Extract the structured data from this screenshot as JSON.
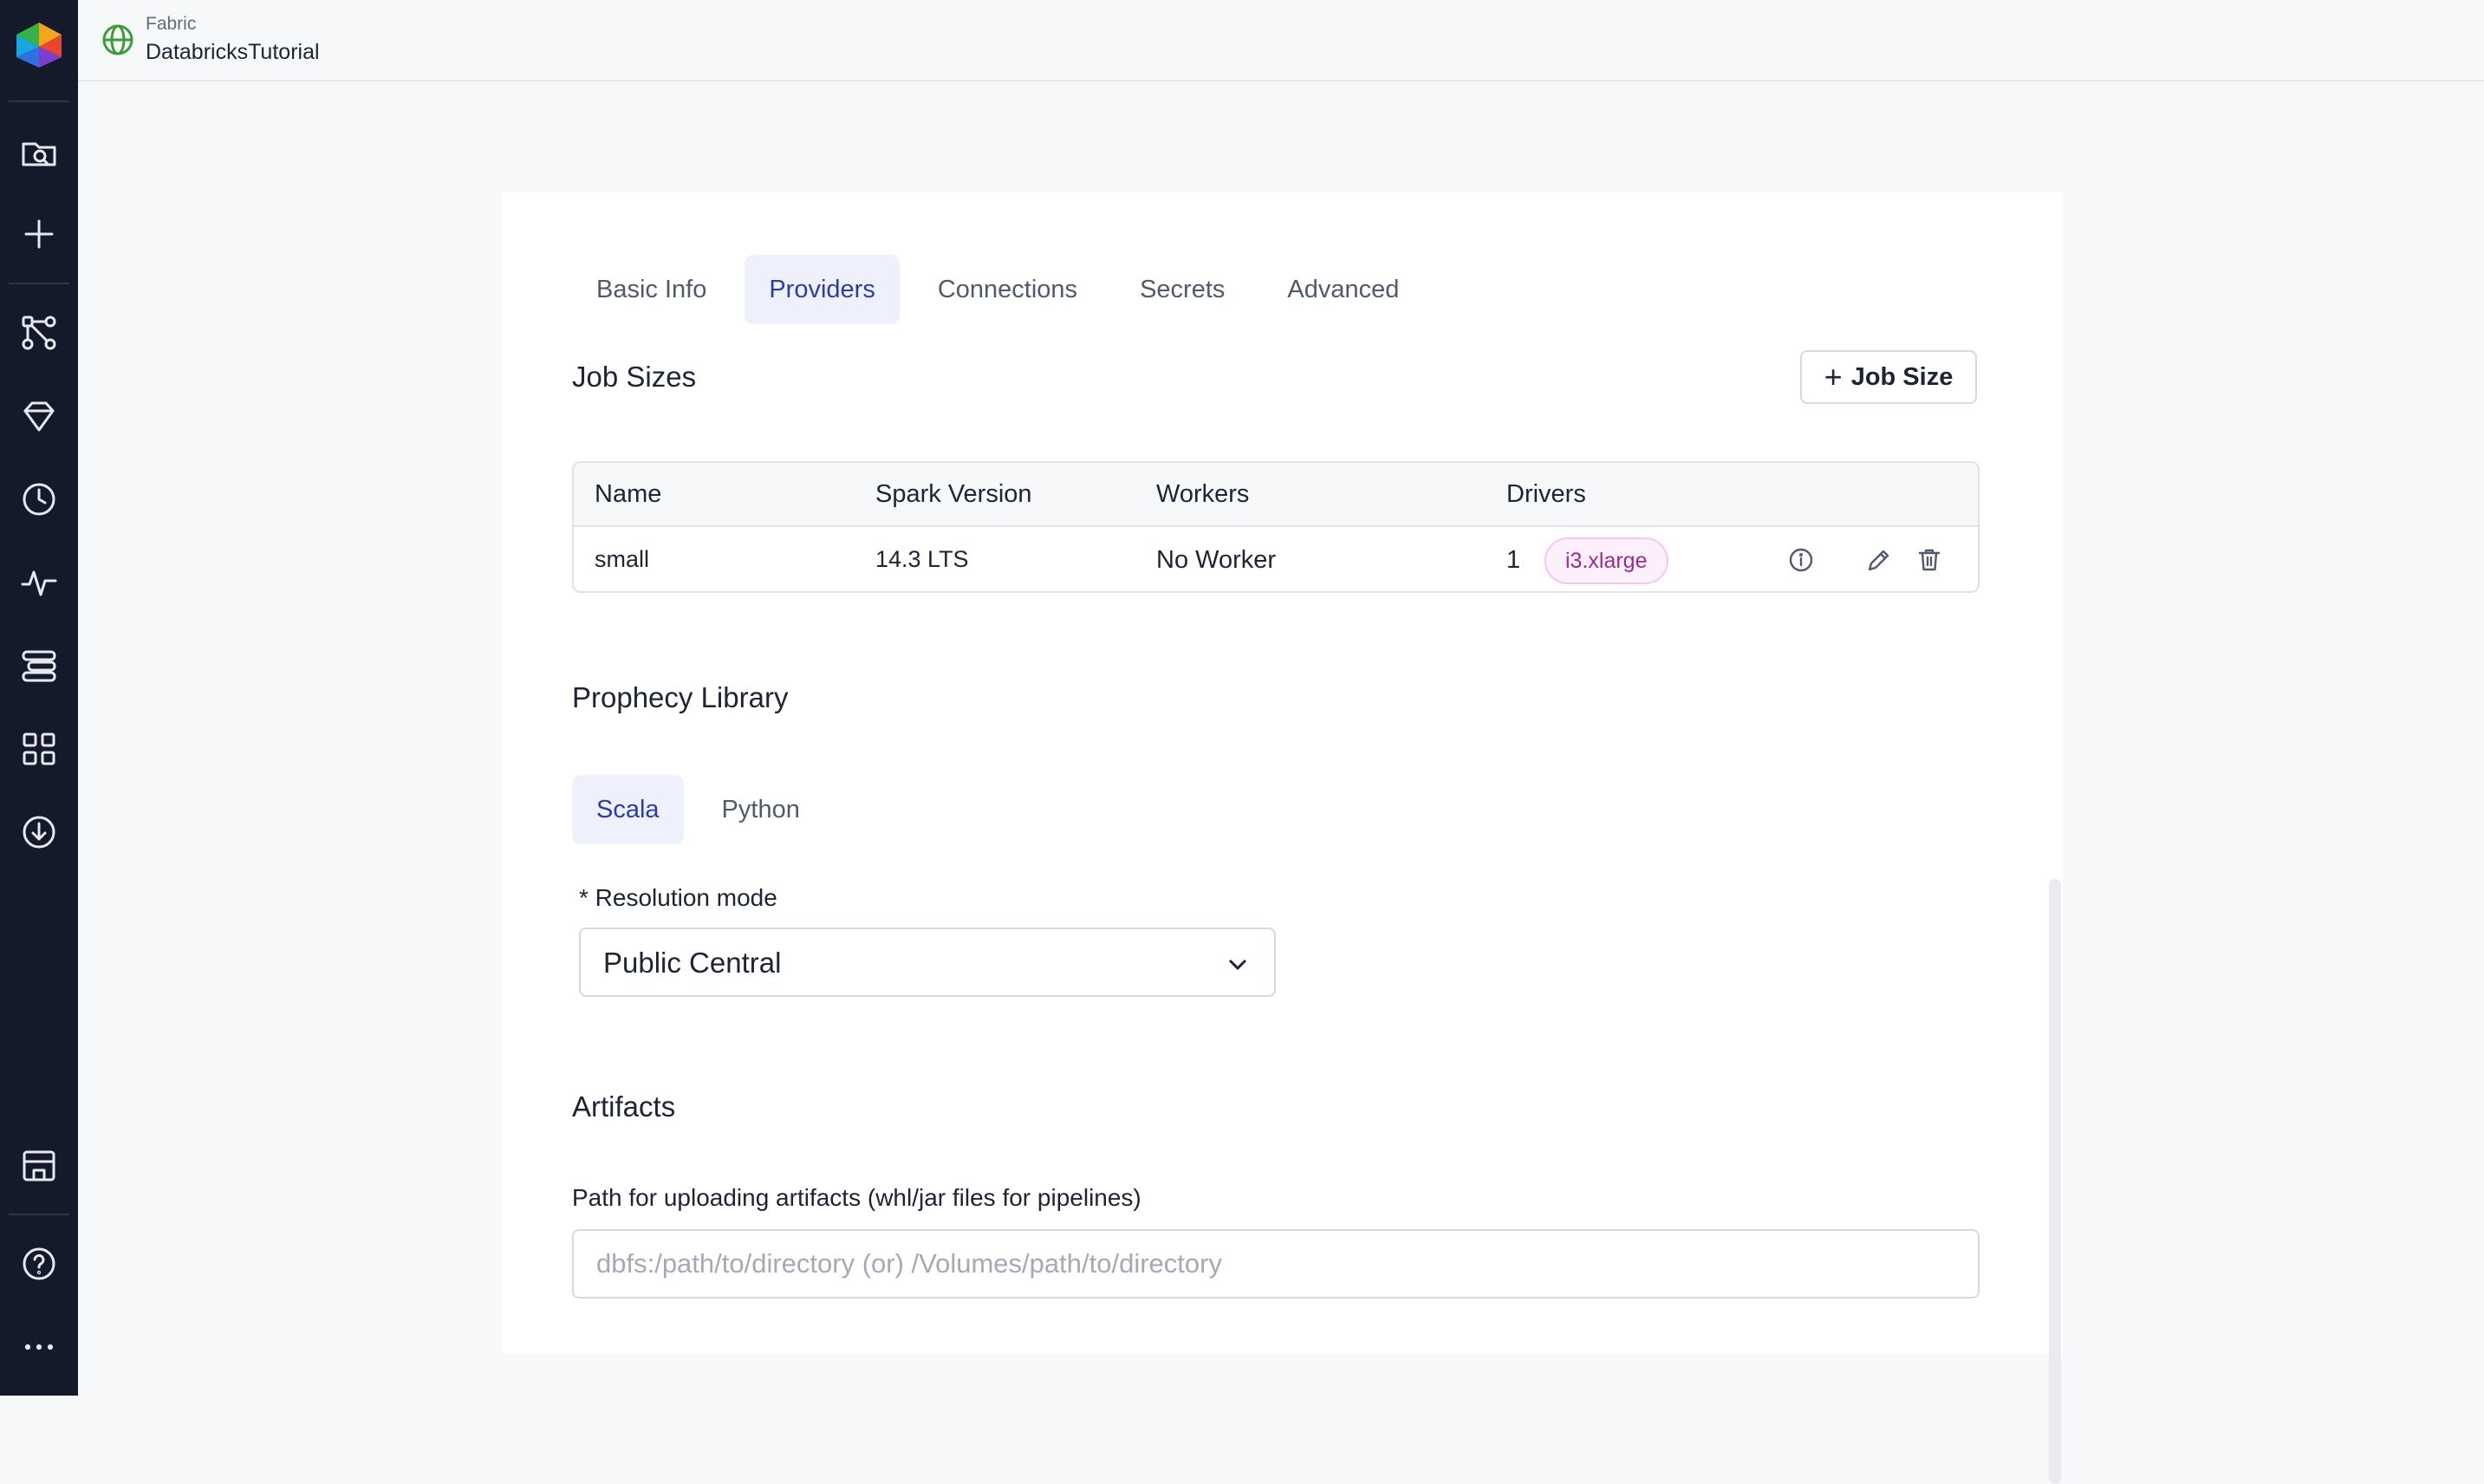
{
  "sidebar": {
    "items": [
      {
        "icon": "folder-search-icon"
      },
      {
        "icon": "plus-icon"
      },
      {
        "icon": "pipeline-icon"
      },
      {
        "icon": "diamond-icon"
      },
      {
        "icon": "clock-icon"
      },
      {
        "icon": "activity-icon"
      },
      {
        "icon": "stack-icon"
      },
      {
        "icon": "grid-icon"
      },
      {
        "icon": "download-icon"
      },
      {
        "icon": "store-icon"
      },
      {
        "icon": "help-icon"
      },
      {
        "icon": "more-icon"
      }
    ]
  },
  "header": {
    "kicker": "Fabric",
    "title": "DatabricksTutorial",
    "icon": "globe-icon"
  },
  "tabs": [
    {
      "label": "Basic Info",
      "active": false
    },
    {
      "label": "Providers",
      "active": true
    },
    {
      "label": "Connections",
      "active": false
    },
    {
      "label": "Secrets",
      "active": false
    },
    {
      "label": "Advanced",
      "active": false
    }
  ],
  "job_sizes": {
    "title": "Job Sizes",
    "add_button": "Job Size",
    "columns": [
      "Name",
      "Spark Version",
      "Workers",
      "Drivers"
    ],
    "rows": [
      {
        "name": "small",
        "spark_version": "14.3 LTS",
        "workers": "No Worker",
        "drivers_count": "1",
        "driver_type": "i3.xlarge"
      }
    ]
  },
  "prophecy_library": {
    "title": "Prophecy Library",
    "tabs": [
      {
        "label": "Scala",
        "active": true
      },
      {
        "label": "Python",
        "active": false
      }
    ],
    "resolution_label": "* Resolution mode",
    "resolution_value": "Public Central"
  },
  "artifacts": {
    "title": "Artifacts",
    "path_label": "Path for uploading artifacts (whl/jar files for pipelines)",
    "path_placeholder": "dbfs:/path/to/directory (or) /Volumes/path/to/directory",
    "path_value": ""
  },
  "colors": {
    "sidebar_bg": "#141a29",
    "accent": "#2e3da0",
    "badge_text": "#9c2a93"
  }
}
